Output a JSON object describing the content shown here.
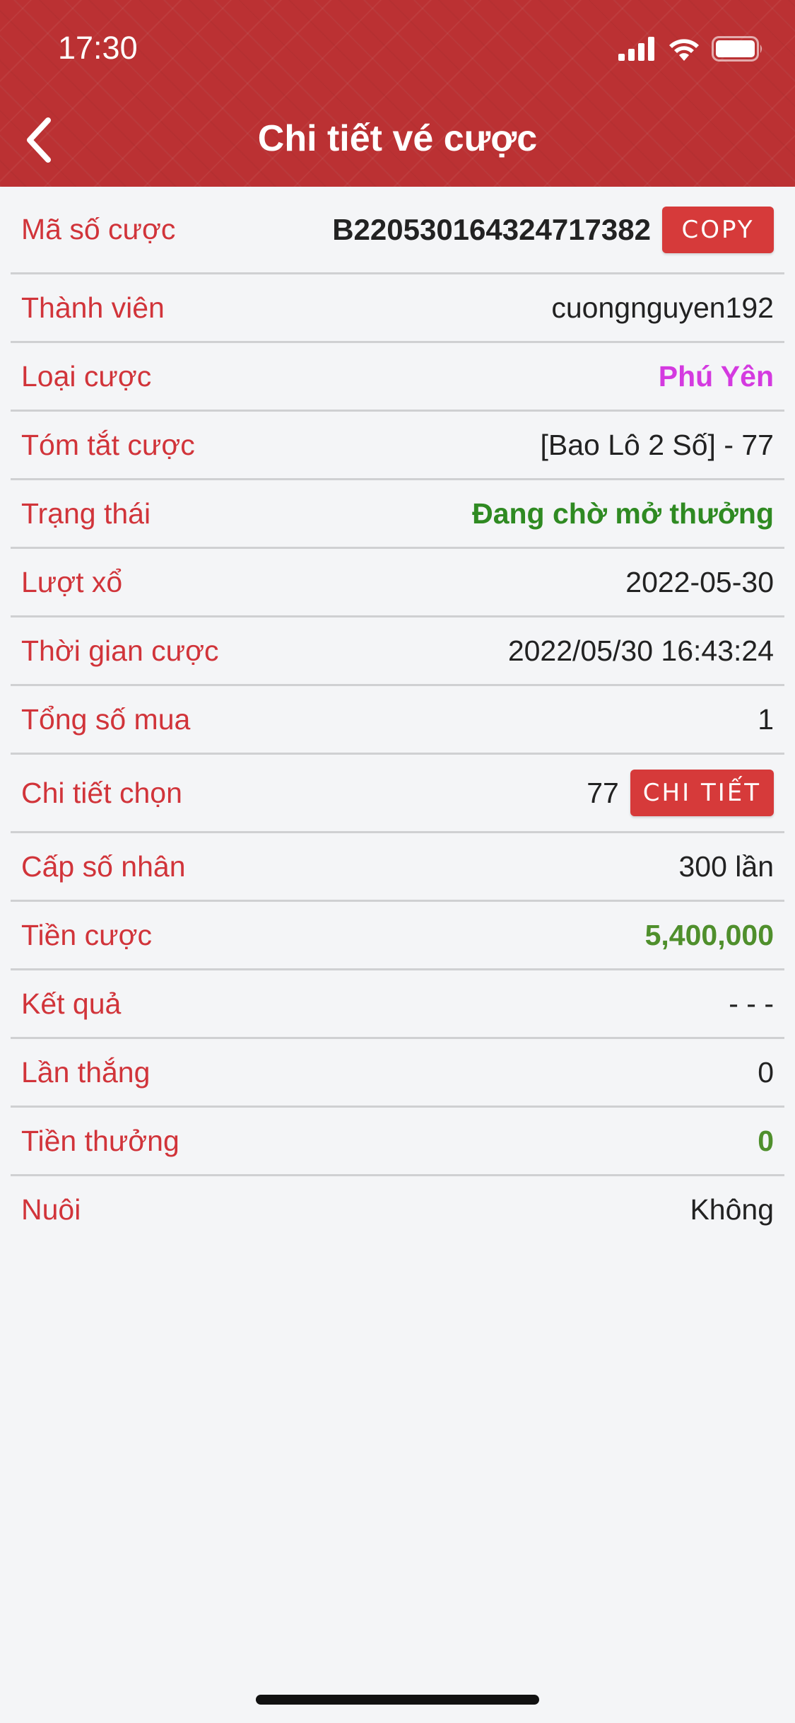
{
  "status_bar": {
    "time": "17:30"
  },
  "header": {
    "title": "Chi tiết vé cược",
    "back_icon": "chevron-left-icon"
  },
  "details": {
    "bet_code": {
      "label": "Mã số cược",
      "value": "B220530164324717382",
      "button": "COPY"
    },
    "member": {
      "label": "Thành viên",
      "value": "cuongnguyen192"
    },
    "bet_type": {
      "label": "Loại cược",
      "value": "Phú Yên",
      "color": "#d43ae0"
    },
    "summary": {
      "label": "Tóm tắt cược",
      "value": "[Bao Lô 2 Số] - 77"
    },
    "status": {
      "label": "Trạng thái",
      "value": "Đang chờ mở thưởng",
      "color": "#2f8a22"
    },
    "draw": {
      "label": "Lượt xổ",
      "value": "2022-05-30"
    },
    "bet_time": {
      "label": "Thời gian cược",
      "value": "2022/05/30 16:43:24"
    },
    "total_purchase": {
      "label": "Tổng số mua",
      "value": "1"
    },
    "selection_detail": {
      "label": "Chi tiết chọn",
      "value": "77",
      "button": "CHI TIẾT"
    },
    "multiplier": {
      "label": "Cấp số nhân",
      "value": "300 lần"
    },
    "bet_amount": {
      "label": "Tiền cược",
      "value": "5,400,000",
      "color": "#4f8f2c"
    },
    "result": {
      "label": "Kết quả",
      "value": "- - -"
    },
    "wins": {
      "label": "Lần thắng",
      "value": "0"
    },
    "prize": {
      "label": "Tiền thưởng",
      "value": "0",
      "color": "#4f8f2c"
    },
    "follow": {
      "label": "Nuôi",
      "value": "Không"
    }
  },
  "colors": {
    "header_bg": "#bb3133",
    "label_red": "#d1343a",
    "button_red": "#d63a3a",
    "background": "#f4f5f7"
  }
}
